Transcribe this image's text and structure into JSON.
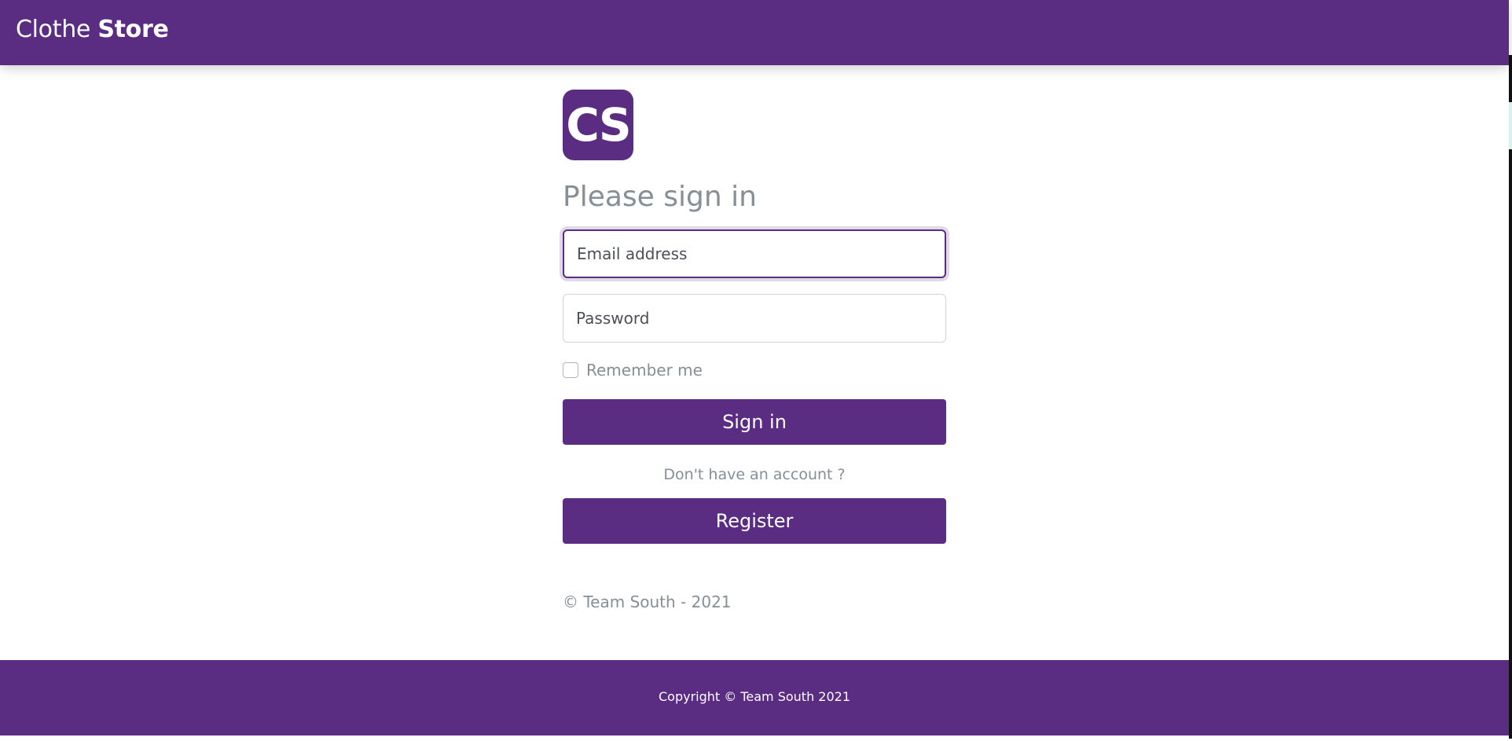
{
  "navbar": {
    "brand_light": "Clothe",
    "brand_bold": "Store"
  },
  "signin": {
    "logo_text": "CS",
    "title": "Please sign in",
    "email_placeholder": "Email address",
    "password_placeholder": "Password",
    "remember_label": "Remember me",
    "remember_checked": false,
    "signin_label": "Sign in",
    "no_account_text": "Don't have an account ?",
    "register_label": "Register",
    "copyright": "© Team South - 2021"
  },
  "footer": {
    "text": "Copyright © Team South 2021"
  },
  "colors": {
    "brand": "#5a2d82",
    "muted_text": "#868e96"
  }
}
